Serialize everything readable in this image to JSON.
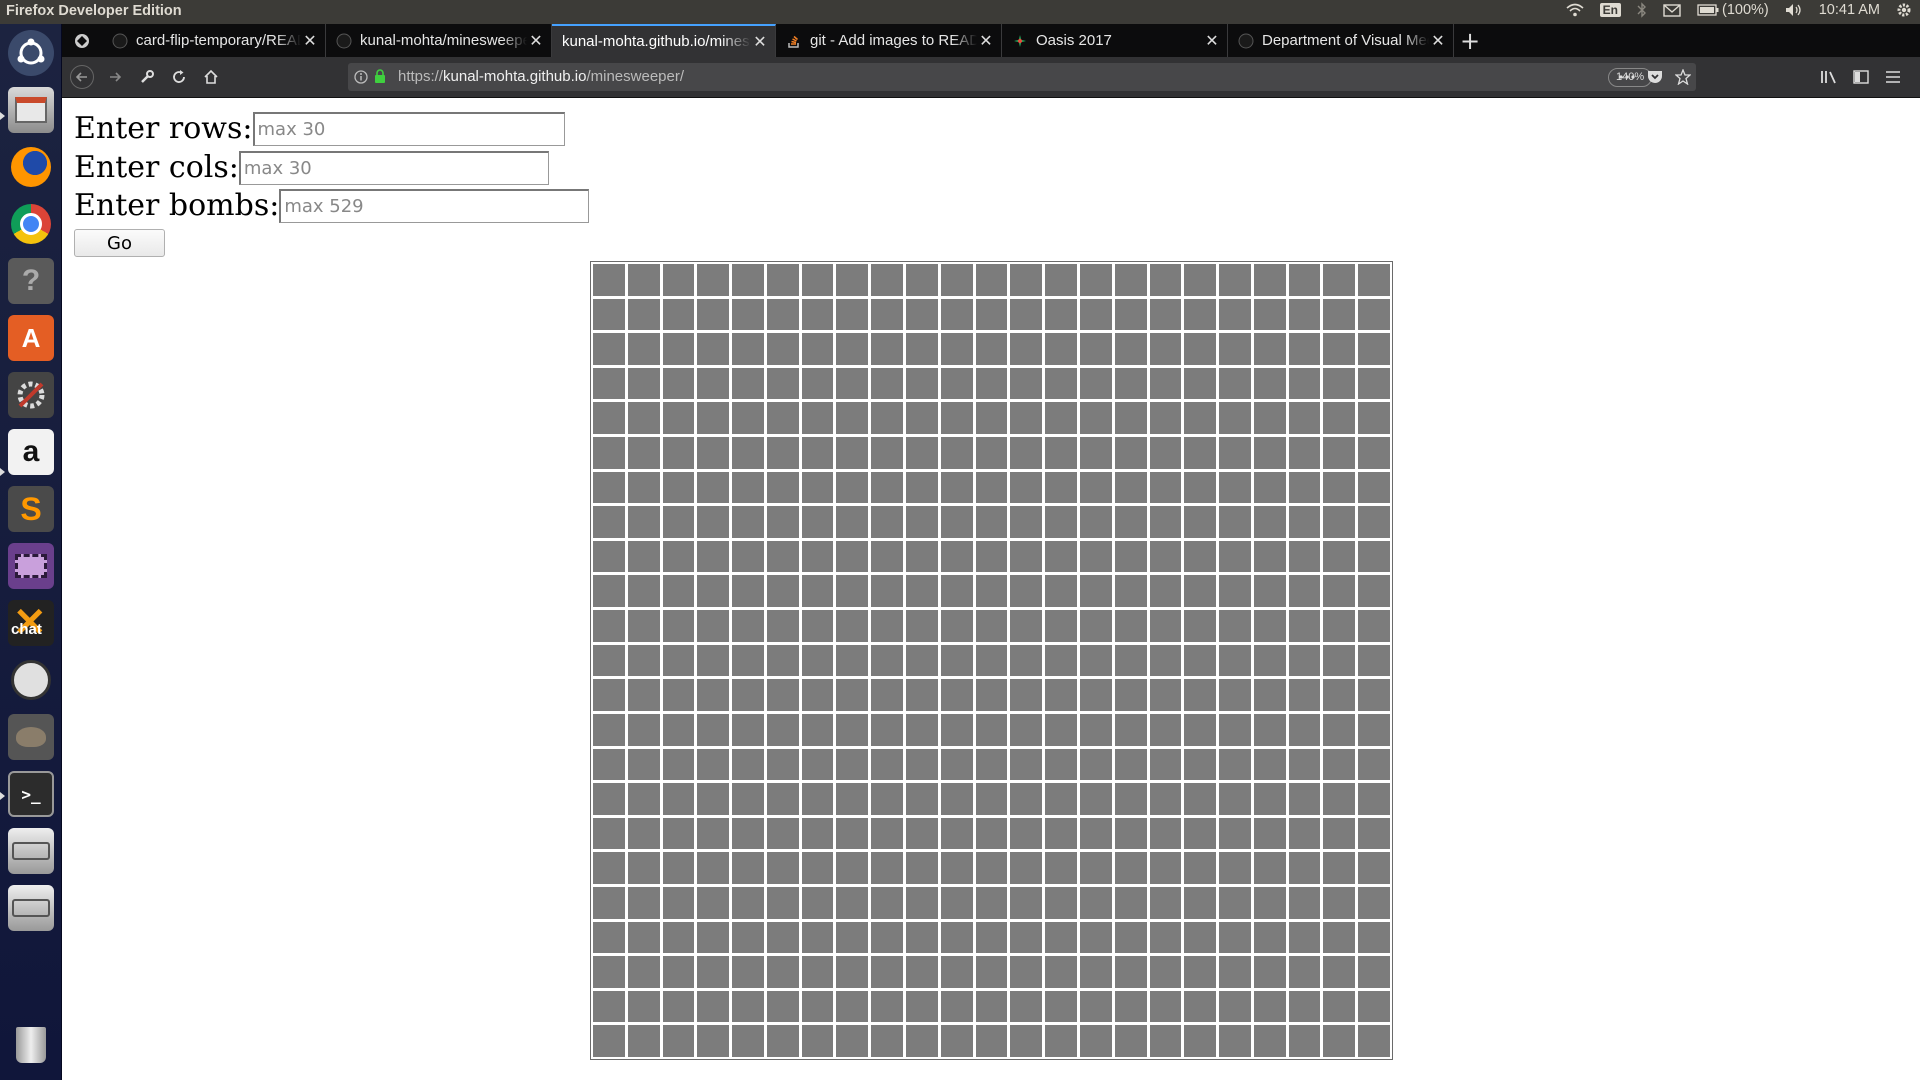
{
  "system_bar": {
    "title": "Firefox Developer Edition",
    "keyboard_layout": "En",
    "battery": "(100%)",
    "time": "10:41 AM"
  },
  "launcher": {
    "items": [
      "ubuntu-dash-icon",
      "files-icon",
      "firefox-icon",
      "chrome-icon",
      "help-icon",
      "software-center-icon",
      "system-settings-icon",
      "amazon-icon",
      "sublime-text-icon",
      "video-editor-icon",
      "xchat-icon",
      "media-player-icon",
      "gimp-icon",
      "terminal-icon",
      "drive-icon",
      "drive-icon",
      "trash-icon"
    ]
  },
  "tabs": [
    {
      "label": "card-flip-temporary/README.md",
      "icon": "github-icon",
      "active": false
    },
    {
      "label": "kunal-mohta/minesweeper",
      "icon": "github-icon",
      "active": false
    },
    {
      "label": "kunal-mohta.github.io/minesweeper/",
      "icon": "blank-page-icon",
      "active": true
    },
    {
      "label": "git - Add images to README",
      "icon": "stackoverflow-icon",
      "active": false
    },
    {
      "label": "Oasis 2017",
      "icon": "oasis-icon",
      "active": false
    },
    {
      "label": "Department of Visual Media",
      "icon": "github-icon",
      "active": false
    }
  ],
  "navbar": {
    "url_scheme": "https://",
    "url_host": "kunal-mohta.github.io",
    "url_path": "/minesweeper/",
    "zoom": "140%"
  },
  "form": {
    "rows_label": "Enter rows:",
    "rows_placeholder": "max 30",
    "rows_value": "",
    "cols_label": "Enter cols:",
    "cols_placeholder": "max 30",
    "cols_value": "",
    "bombs_label": "Enter bombs:",
    "bombs_placeholder": "max 529",
    "bombs_value": "",
    "go_label": "Go"
  },
  "board": {
    "rows": 23,
    "cols": 23,
    "cell_color": "#7c7c7c",
    "state": "all-covered"
  },
  "colors": {
    "tab_accent": "#45a1ff",
    "launcher_bg": "#1c2340",
    "system_bar_bg": "#3c3b37"
  }
}
